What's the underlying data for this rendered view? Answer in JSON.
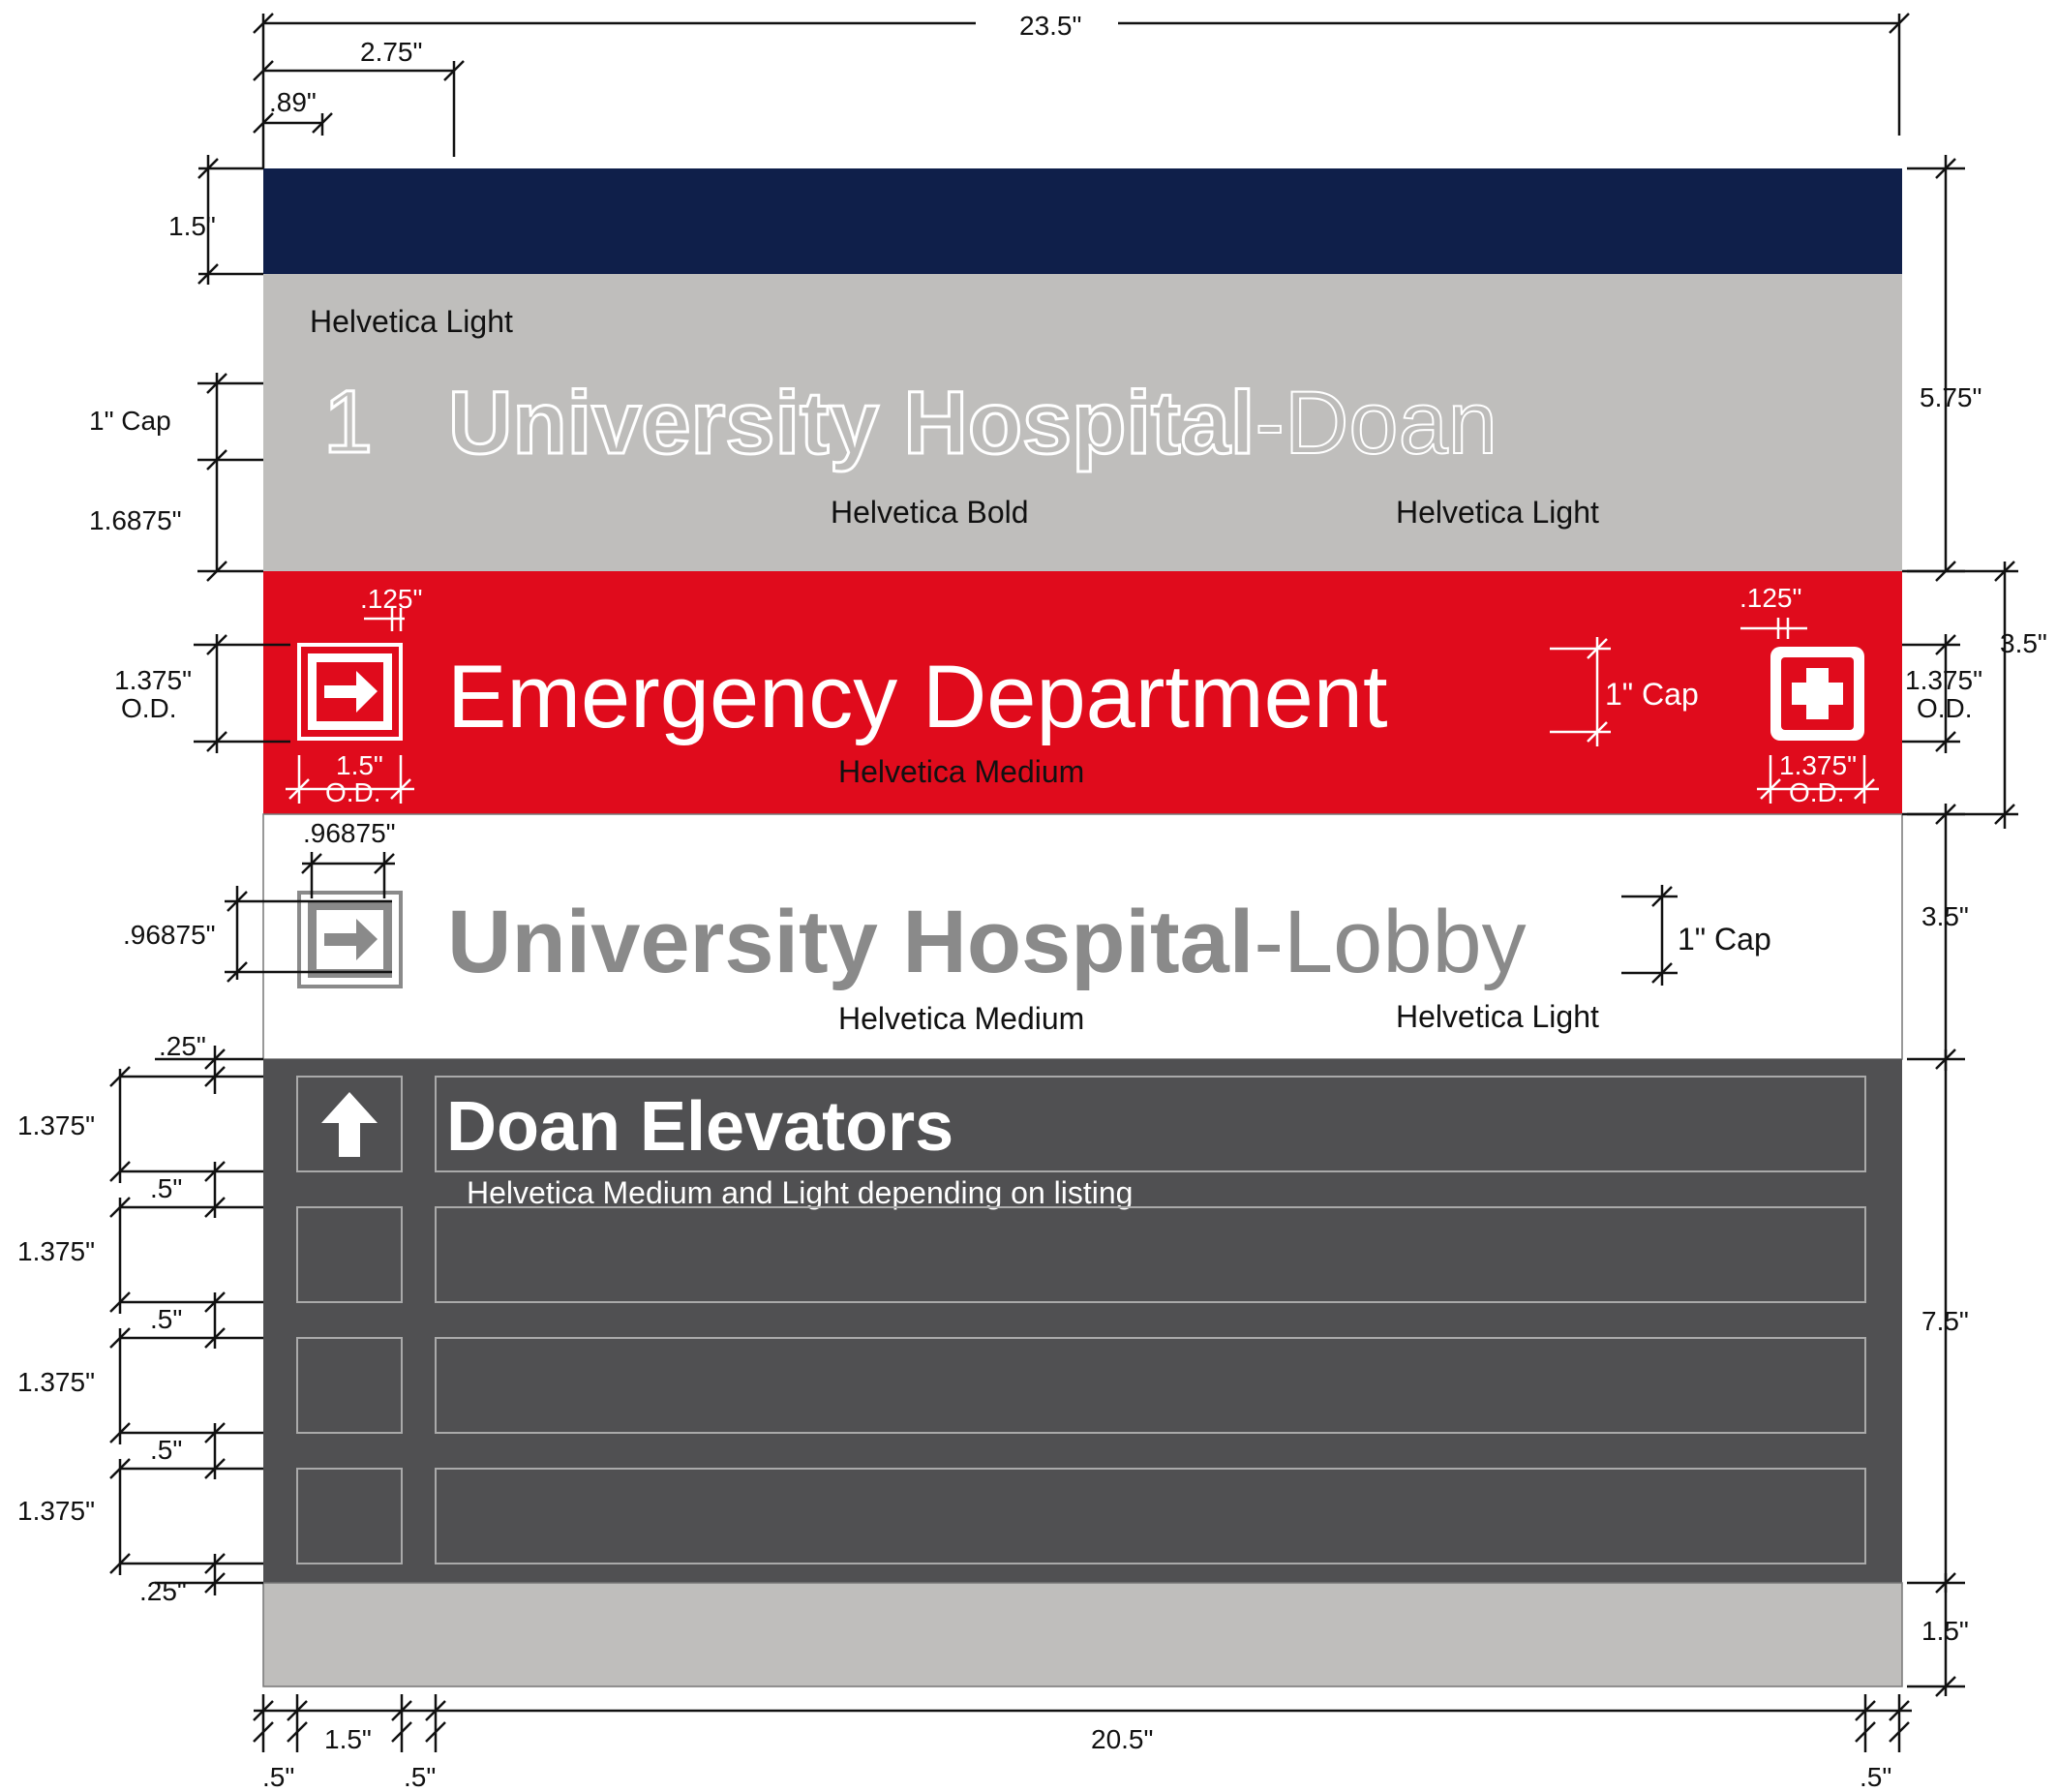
{
  "colors": {
    "navy": "#0f1f4a",
    "gray": "#bfbebc",
    "red": "#e00b1c",
    "white": "#ffffff",
    "charcoal": "#505052",
    "text_gray": "#8a8a8a"
  },
  "sign": {
    "floor_number": "1",
    "hospital_name_bold": "University Hospital",
    "hospital_name_light": "-Doan",
    "emergency_label": "Emergency Department",
    "lobby_bold": "University Hospital",
    "lobby_light": "-Lobby",
    "directory_first_entry": "Doan Elevators"
  },
  "icons": {
    "emergency_arrow": "arrow-right-icon",
    "emergency_cross": "medical-cross-icon",
    "lobby_arrow": "arrow-right-icon",
    "elevator_arrow": "arrow-up-icon"
  },
  "font_notes": {
    "header_note": "Helvetica Light",
    "hospital_bold_note": "Helvetica Bold",
    "hospital_light_note": "Helvetica Light",
    "emergency_note": "Helvetica Medium",
    "lobby_medium_note": "Helvetica Medium",
    "lobby_light_note": "Helvetica Light",
    "directory_note": "Helvetica Medium and Light depending on listing"
  },
  "dimensions": {
    "overall_width": "23.5\"",
    "first_col": "2.75\"",
    "margin_left": ".89\"",
    "navy_band": "1.5\"",
    "cap_1": "1\" Cap",
    "below_cap": "1.6875\"",
    "gray_band": "5.75\"",
    "red_gap_left": ".125\"",
    "red_gap_right": ".125\"",
    "red_icon_height_left": "1.375\"",
    "red_icon_od_left": "O.D.",
    "red_icon_width_left": "1.5\"",
    "red_icon_width_od_left": "O.D.",
    "red_cap": "1\" Cap",
    "red_icon_height_right": "1.375\"",
    "red_icon_od_right": "O.D.",
    "red_icon_width_right": "1.375\"",
    "red_icon_width_od_right": "O.D.",
    "red_band": "3.5\"",
    "lobby_icon_width": ".96875\"",
    "lobby_icon_height": ".96875\"",
    "lobby_cap": "1\" Cap",
    "white_band": "3.5\"",
    "dir_top_gap": ".25\"",
    "dir_row_1": "1.375\"",
    "dir_gap_1": ".5\"",
    "dir_row_2": "1.375\"",
    "dir_gap_2": ".5\"",
    "dir_row_3": "1.375\"",
    "dir_gap_3": ".5\"",
    "dir_row_4": "1.375\"",
    "dir_bottom_gap": ".25\"",
    "dir_band": "7.5\"",
    "bottom_band": "1.5\"",
    "bottom_margin_left": ".5\"",
    "bottom_icon_col": "1.5\"",
    "bottom_gap": ".5\"",
    "bottom_text_col": "20.5\"",
    "bottom_margin_right": ".5\""
  }
}
